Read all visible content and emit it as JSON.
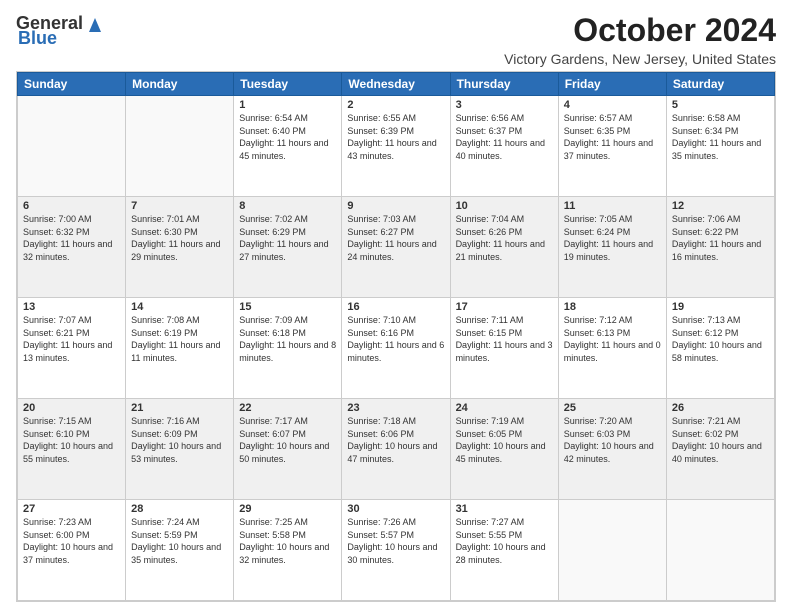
{
  "logo": {
    "general": "General",
    "blue": "Blue"
  },
  "title": "October 2024",
  "subtitle": "Victory Gardens, New Jersey, United States",
  "headers": [
    "Sunday",
    "Monday",
    "Tuesday",
    "Wednesday",
    "Thursday",
    "Friday",
    "Saturday"
  ],
  "weeks": [
    [
      {
        "day": "",
        "info": ""
      },
      {
        "day": "",
        "info": ""
      },
      {
        "day": "1",
        "info": "Sunrise: 6:54 AM\nSunset: 6:40 PM\nDaylight: 11 hours and 45 minutes."
      },
      {
        "day": "2",
        "info": "Sunrise: 6:55 AM\nSunset: 6:39 PM\nDaylight: 11 hours and 43 minutes."
      },
      {
        "day": "3",
        "info": "Sunrise: 6:56 AM\nSunset: 6:37 PM\nDaylight: 11 hours and 40 minutes."
      },
      {
        "day": "4",
        "info": "Sunrise: 6:57 AM\nSunset: 6:35 PM\nDaylight: 11 hours and 37 minutes."
      },
      {
        "day": "5",
        "info": "Sunrise: 6:58 AM\nSunset: 6:34 PM\nDaylight: 11 hours and 35 minutes."
      }
    ],
    [
      {
        "day": "6",
        "info": "Sunrise: 7:00 AM\nSunset: 6:32 PM\nDaylight: 11 hours and 32 minutes."
      },
      {
        "day": "7",
        "info": "Sunrise: 7:01 AM\nSunset: 6:30 PM\nDaylight: 11 hours and 29 minutes."
      },
      {
        "day": "8",
        "info": "Sunrise: 7:02 AM\nSunset: 6:29 PM\nDaylight: 11 hours and 27 minutes."
      },
      {
        "day": "9",
        "info": "Sunrise: 7:03 AM\nSunset: 6:27 PM\nDaylight: 11 hours and 24 minutes."
      },
      {
        "day": "10",
        "info": "Sunrise: 7:04 AM\nSunset: 6:26 PM\nDaylight: 11 hours and 21 minutes."
      },
      {
        "day": "11",
        "info": "Sunrise: 7:05 AM\nSunset: 6:24 PM\nDaylight: 11 hours and 19 minutes."
      },
      {
        "day": "12",
        "info": "Sunrise: 7:06 AM\nSunset: 6:22 PM\nDaylight: 11 hours and 16 minutes."
      }
    ],
    [
      {
        "day": "13",
        "info": "Sunrise: 7:07 AM\nSunset: 6:21 PM\nDaylight: 11 hours and 13 minutes."
      },
      {
        "day": "14",
        "info": "Sunrise: 7:08 AM\nSunset: 6:19 PM\nDaylight: 11 hours and 11 minutes."
      },
      {
        "day": "15",
        "info": "Sunrise: 7:09 AM\nSunset: 6:18 PM\nDaylight: 11 hours and 8 minutes."
      },
      {
        "day": "16",
        "info": "Sunrise: 7:10 AM\nSunset: 6:16 PM\nDaylight: 11 hours and 6 minutes."
      },
      {
        "day": "17",
        "info": "Sunrise: 7:11 AM\nSunset: 6:15 PM\nDaylight: 11 hours and 3 minutes."
      },
      {
        "day": "18",
        "info": "Sunrise: 7:12 AM\nSunset: 6:13 PM\nDaylight: 11 hours and 0 minutes."
      },
      {
        "day": "19",
        "info": "Sunrise: 7:13 AM\nSunset: 6:12 PM\nDaylight: 10 hours and 58 minutes."
      }
    ],
    [
      {
        "day": "20",
        "info": "Sunrise: 7:15 AM\nSunset: 6:10 PM\nDaylight: 10 hours and 55 minutes."
      },
      {
        "day": "21",
        "info": "Sunrise: 7:16 AM\nSunset: 6:09 PM\nDaylight: 10 hours and 53 minutes."
      },
      {
        "day": "22",
        "info": "Sunrise: 7:17 AM\nSunset: 6:07 PM\nDaylight: 10 hours and 50 minutes."
      },
      {
        "day": "23",
        "info": "Sunrise: 7:18 AM\nSunset: 6:06 PM\nDaylight: 10 hours and 47 minutes."
      },
      {
        "day": "24",
        "info": "Sunrise: 7:19 AM\nSunset: 6:05 PM\nDaylight: 10 hours and 45 minutes."
      },
      {
        "day": "25",
        "info": "Sunrise: 7:20 AM\nSunset: 6:03 PM\nDaylight: 10 hours and 42 minutes."
      },
      {
        "day": "26",
        "info": "Sunrise: 7:21 AM\nSunset: 6:02 PM\nDaylight: 10 hours and 40 minutes."
      }
    ],
    [
      {
        "day": "27",
        "info": "Sunrise: 7:23 AM\nSunset: 6:00 PM\nDaylight: 10 hours and 37 minutes."
      },
      {
        "day": "28",
        "info": "Sunrise: 7:24 AM\nSunset: 5:59 PM\nDaylight: 10 hours and 35 minutes."
      },
      {
        "day": "29",
        "info": "Sunrise: 7:25 AM\nSunset: 5:58 PM\nDaylight: 10 hours and 32 minutes."
      },
      {
        "day": "30",
        "info": "Sunrise: 7:26 AM\nSunset: 5:57 PM\nDaylight: 10 hours and 30 minutes."
      },
      {
        "day": "31",
        "info": "Sunrise: 7:27 AM\nSunset: 5:55 PM\nDaylight: 10 hours and 28 minutes."
      },
      {
        "day": "",
        "info": ""
      },
      {
        "day": "",
        "info": ""
      }
    ]
  ]
}
